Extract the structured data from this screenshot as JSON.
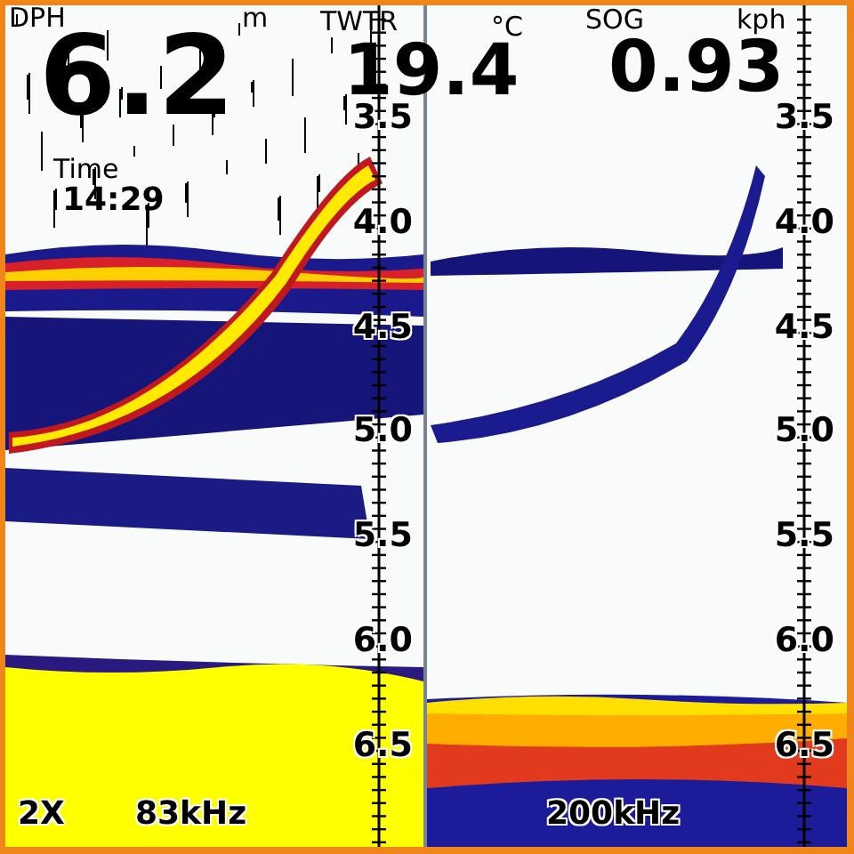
{
  "depth": {
    "label": "DPH",
    "value": "6.2",
    "unit": "m"
  },
  "water_temp": {
    "label": "TWTR",
    "value": "19.4",
    "unit": "°C"
  },
  "speed": {
    "label": "SOG",
    "value": "0.93",
    "unit": "kph"
  },
  "time": {
    "label": "Time",
    "value": "14:29"
  },
  "left_panel": {
    "zoom": "2X",
    "frequency": "83kHz",
    "scale": [
      "3.5",
      "4.0",
      "4.5",
      "5.0",
      "5.5",
      "6.0",
      "6.5"
    ]
  },
  "right_panel": {
    "frequency": "200kHz",
    "scale": [
      "3.5",
      "4.0",
      "4.5",
      "5.0",
      "5.5",
      "6.0",
      "6.5"
    ]
  }
}
